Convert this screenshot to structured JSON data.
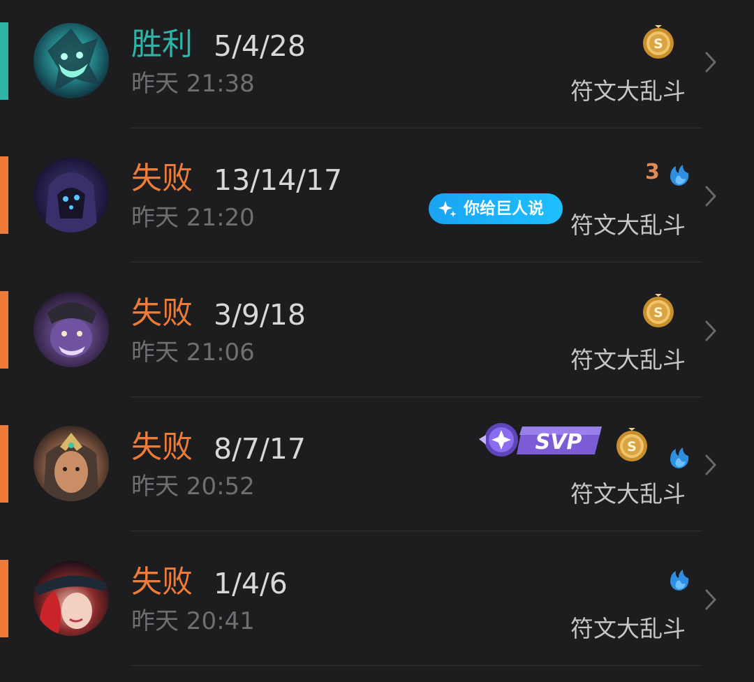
{
  "colors": {
    "win": "#2fb5a7",
    "loss": "#ee7c38",
    "kda": "#d8d8d8",
    "time": "#6f6f72",
    "mode": "#c6c6c8",
    "ai_pill": "#1aa3f2",
    "svp_purple": "#7b5cd6",
    "coin_gold": "#d9a441",
    "flame_blue": "#2e8fe0"
  },
  "matches": [
    {
      "result": "胜利",
      "outcome": "win",
      "kda": "5/4/28",
      "time": "昨天 21:38",
      "mode": "符文大乱斗",
      "avatar": "champion-avatar-teal-monster",
      "badges": [
        "gold-coin-icon"
      ]
    },
    {
      "result": "失败",
      "outcome": "loss",
      "kda": "13/14/17",
      "time": "昨天 21:20",
      "mode": "符文大乱斗",
      "avatar": "champion-avatar-hooded-robot",
      "badges": [
        "triple-kill-badge",
        "flame-icon"
      ],
      "badge_number": "3",
      "ai_pill": "你给巨人说"
    },
    {
      "result": "失败",
      "outcome": "loss",
      "kda": "3/9/18",
      "time": "昨天 21:06",
      "mode": "符文大乱斗",
      "avatar": "champion-avatar-purple-brute",
      "badges": [
        "gold-coin-icon"
      ]
    },
    {
      "result": "失败",
      "outcome": "loss",
      "kda": "8/7/17",
      "time": "昨天 20:52",
      "mode": "符文大乱斗",
      "avatar": "champion-avatar-crowned-woman",
      "badges": [
        "svp-badge",
        "gold-coin-icon",
        "flame-icon"
      ],
      "svp_label": "SVP"
    },
    {
      "result": "失败",
      "outcome": "loss",
      "kda": "1/4/6",
      "time": "昨天 20:41",
      "mode": "符文大乱斗",
      "avatar": "champion-avatar-red-hair-hat",
      "badges": [
        "flame-icon"
      ]
    }
  ]
}
